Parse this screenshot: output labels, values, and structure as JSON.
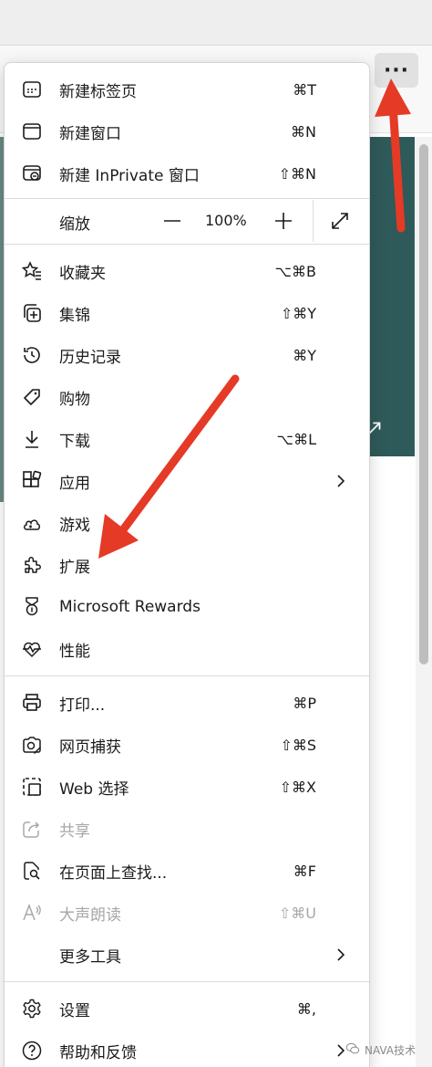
{
  "browser": {
    "more_button_label": "···",
    "banner_icon": "expand-diagonal-icon"
  },
  "menu": {
    "group1": [
      {
        "label": "新建标签页",
        "shortcut": "⌘T",
        "icon": "new-tab-icon"
      },
      {
        "label": "新建窗口",
        "shortcut": "⌘N",
        "icon": "new-window-icon"
      },
      {
        "label": "新建 InPrivate 窗口",
        "shortcut": "⇧⌘N",
        "icon": "inprivate-window-icon"
      }
    ],
    "zoom": {
      "label": "缩放",
      "minus": "—",
      "value": "100%",
      "plus": "+",
      "fullscreen_icon": "fullscreen-icon"
    },
    "group2": [
      {
        "label": "收藏夹",
        "shortcut": "⌥⌘B",
        "icon": "favorites-icon"
      },
      {
        "label": "集锦",
        "shortcut": "⇧⌘Y",
        "icon": "collections-icon"
      },
      {
        "label": "历史记录",
        "shortcut": "⌘Y",
        "icon": "history-icon"
      },
      {
        "label": "购物",
        "shortcut": "",
        "icon": "shopping-tag-icon"
      },
      {
        "label": "下载",
        "shortcut": "⌥⌘L",
        "icon": "download-icon"
      },
      {
        "label": "应用",
        "shortcut": "",
        "icon": "apps-icon",
        "submenu": true
      },
      {
        "label": "游戏",
        "shortcut": "",
        "icon": "games-icon"
      },
      {
        "label": "扩展",
        "shortcut": "",
        "icon": "extensions-puzzle-icon"
      },
      {
        "label": "Microsoft Rewards",
        "shortcut": "",
        "icon": "rewards-medal-icon"
      },
      {
        "label": "性能",
        "shortcut": "",
        "icon": "performance-heart-icon"
      }
    ],
    "group3": [
      {
        "label": "打印...",
        "shortcut": "⌘P",
        "icon": "print-icon"
      },
      {
        "label": "网页捕获",
        "shortcut": "⇧⌘S",
        "icon": "web-capture-icon"
      },
      {
        "label": "Web 选择",
        "shortcut": "⇧⌘X",
        "icon": "web-select-icon"
      },
      {
        "label": "共享",
        "shortcut": "",
        "icon": "share-icon",
        "disabled": true
      },
      {
        "label": "在页面上查找...",
        "shortcut": "⌘F",
        "icon": "find-on-page-icon"
      },
      {
        "label": "大声朗读",
        "shortcut": "⇧⌘U",
        "icon": "read-aloud-icon",
        "disabled": true
      },
      {
        "label": "更多工具",
        "shortcut": "",
        "icon": "",
        "submenu": true
      }
    ],
    "group4": [
      {
        "label": "设置",
        "shortcut": "⌘,",
        "icon": "settings-gear-icon"
      },
      {
        "label": "帮助和反馈",
        "shortcut": "",
        "icon": "help-icon",
        "submenu": true
      }
    ]
  },
  "watermark": {
    "text": "NAVA技术"
  },
  "colors": {
    "annotation_red": "#e53a26",
    "banner_teal": "#2f5a5a",
    "divider": "#dcdcdc"
  }
}
